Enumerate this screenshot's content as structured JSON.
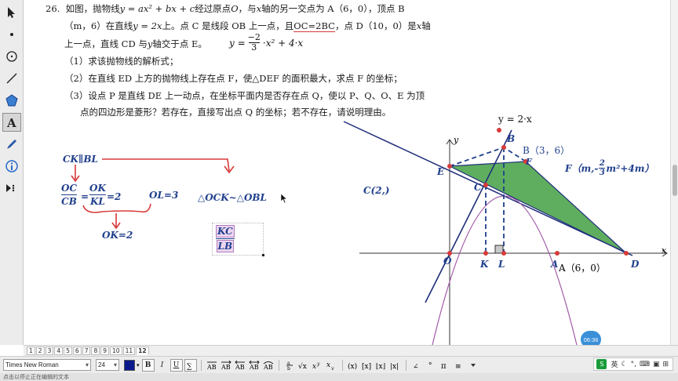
{
  "problem": {
    "number": "26.",
    "line1a": "如图，抛物线",
    "line1_eq": "y = ax² + bx + c",
    "line1b": "经过原点",
    "line1_o": "O",
    "line1c": "，与",
    "line1_x": "x",
    "line1d": "轴的另一交点为 A（6，0），顶点 B",
    "line2a": "（m，6）在直线",
    "line2_eq": "y = 2x",
    "line2b": "上。点 C 是线段 OB 上一点，且",
    "line2_under": "OC=2BC",
    "line2c": "，点 D（10，0）是",
    "line2_x": "x",
    "line2d": "轴",
    "line3a": "上一点，直线 CD 与",
    "line3_y": "y",
    "line3b": "轴交于点 E。",
    "formula_lhs": "y =",
    "formula_num": "−2",
    "formula_den": "3",
    "formula_rhs": "·x² + 4·x",
    "q1": "（1）求该抛物线的解析式；",
    "q2": "（2）在直线 ED 上方的抛物线上存在点 F，使△DEF 的面积最大，求点 F 的坐标；",
    "q3a": "（3）设点 P 是直线 DE 上一动点，在坐标平面内是否存在点 Q，使以 P、Q、O、E 为顶",
    "q3b": "点的四边形是菱形？若存在，直接写出点 Q 的坐标；若不存在，请说明理由。"
  },
  "annotations": {
    "ck_bl": "CK∥BL",
    "frac1_num": "OC",
    "frac1_den": "CB",
    "eq": "=",
    "frac2_num": "OK",
    "frac2_den": "KL",
    "eq2": "=2",
    "ol": "OL=3",
    "ok": "OK=2",
    "similar": "△OCK~△OBL",
    "box_num": "KC",
    "box_den": "LB",
    "c_label": "C(2,)",
    "f_label": "F（m,-",
    "f_num": "2",
    "f_den": "3",
    "f_tail": "m²+4m）"
  },
  "graph": {
    "line_label": "y = 2·x",
    "y_axis": "y",
    "x_axis": "x",
    "points": {
      "B": "B",
      "B_coord": "B（3，6）",
      "E": "E",
      "F": "F",
      "C": "C",
      "O": "O",
      "K": "K",
      "L": "L",
      "A": "A",
      "A_coord": "A（6，0）",
      "D": "D"
    },
    "colors": {
      "fill": "#5fae5f",
      "line": "#1f2f7a",
      "parabola": "#a05aa8",
      "dashed": "#1f3f8c",
      "point": "#d83a3a"
    }
  },
  "page_tabs": [
    "1",
    "2",
    "3",
    "4",
    "5",
    "6",
    "7",
    "8",
    "9",
    "10",
    "11",
    "12"
  ],
  "active_tab": "12",
  "toolbar": {
    "font": "Times New Roman",
    "size": "24",
    "bold": "B",
    "italic": "I",
    "underline": "U"
  },
  "timer": "06:36",
  "status": "点击以停止正在编辑的文本",
  "ime": {
    "lang": "英"
  }
}
